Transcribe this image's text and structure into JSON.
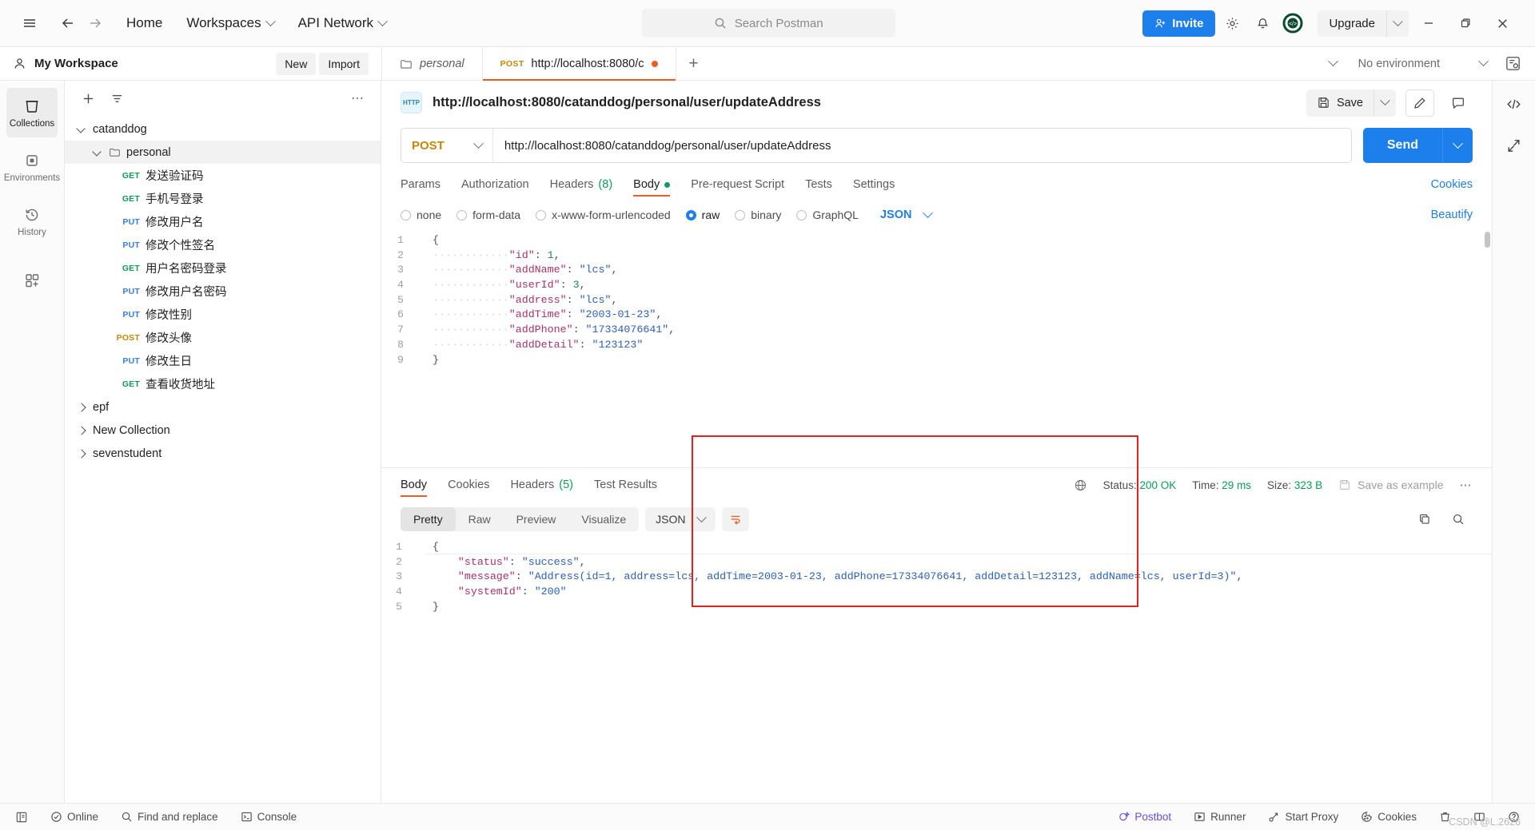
{
  "titlebar": {
    "menu_icon": "hamburger-icon",
    "back_icon": "back-arrow-icon",
    "forward_icon": "forward-arrow-icon",
    "home": "Home",
    "workspaces": "Workspaces",
    "api_network": "API Network",
    "search_placeholder": "Search Postman",
    "invite": "Invite",
    "settings_icon": "gear-icon",
    "notifications_icon": "bell-icon",
    "account_icon": "account-avatar-icon",
    "upgrade": "Upgrade",
    "minimize": "–",
    "maximize": "❐",
    "close": "✕"
  },
  "workspace": {
    "name": "My Workspace",
    "new": "New",
    "import": "Import"
  },
  "tabs": {
    "items": [
      {
        "label": "personal",
        "method": "",
        "active": false,
        "italic": true,
        "icon": "folder-icon"
      },
      {
        "label": "http://localhost:8080/c",
        "method": "POST",
        "active": true,
        "italic": false,
        "unsaved": true
      }
    ],
    "add": "+",
    "environment": "No environment"
  },
  "rail": {
    "items": [
      {
        "label": "Collections",
        "icon": "collections-icon",
        "active": true
      },
      {
        "label": "Environments",
        "icon": "environments-icon",
        "active": false
      },
      {
        "label": "History",
        "icon": "history-icon",
        "active": false
      },
      {
        "label": "",
        "icon": "add-apps-icon",
        "active": false
      }
    ]
  },
  "sidebar": {
    "add_icon": "plus-icon",
    "filter_icon": "filter-icon",
    "more_icon": "more-options-icon",
    "tree": [
      {
        "depth": 0,
        "type": "collection",
        "label": "catanddog",
        "expanded": true
      },
      {
        "depth": 1,
        "type": "folder",
        "label": "personal",
        "expanded": true,
        "selected": true
      },
      {
        "depth": 2,
        "type": "request",
        "method": "GET",
        "label": "发送验证码"
      },
      {
        "depth": 2,
        "type": "request",
        "method": "GET",
        "label": "手机号登录"
      },
      {
        "depth": 2,
        "type": "request",
        "method": "PUT",
        "label": "修改用户名"
      },
      {
        "depth": 2,
        "type": "request",
        "method": "PUT",
        "label": "修改个性签名"
      },
      {
        "depth": 2,
        "type": "request",
        "method": "GET",
        "label": "用户名密码登录"
      },
      {
        "depth": 2,
        "type": "request",
        "method": "PUT",
        "label": "修改用户名密码"
      },
      {
        "depth": 2,
        "type": "request",
        "method": "PUT",
        "label": "修改性别"
      },
      {
        "depth": 2,
        "type": "request",
        "method": "POST",
        "label": "修改头像"
      },
      {
        "depth": 2,
        "type": "request",
        "method": "PUT",
        "label": "修改生日"
      },
      {
        "depth": 2,
        "type": "request",
        "method": "GET",
        "label": "查看收货地址"
      },
      {
        "depth": 0,
        "type": "collection",
        "label": "epf",
        "expanded": false
      },
      {
        "depth": 0,
        "type": "collection",
        "label": "New Collection",
        "expanded": false
      },
      {
        "depth": 0,
        "type": "collection",
        "label": "sevenstudent",
        "expanded": false
      }
    ]
  },
  "request": {
    "protocol_badge": "HTTP",
    "title": "http://localhost:8080/catanddog/personal/user/updateAddress",
    "save": "Save",
    "edit_icon": "pencil-icon",
    "comment_icon": "comment-icon",
    "method": "POST",
    "url": "http://localhost:8080/catanddog/personal/user/updateAddress",
    "send": "Send",
    "tabs": [
      {
        "label": "Params",
        "active": false
      },
      {
        "label": "Authorization",
        "active": false
      },
      {
        "label": "Headers",
        "count": "(8)",
        "active": false
      },
      {
        "label": "Body",
        "dot": true,
        "active": true
      },
      {
        "label": "Pre-request Script",
        "active": false
      },
      {
        "label": "Tests",
        "active": false
      },
      {
        "label": "Settings",
        "active": false
      }
    ],
    "cookies": "Cookies",
    "body_types": [
      {
        "label": "none",
        "selected": false
      },
      {
        "label": "form-data",
        "selected": false
      },
      {
        "label": "x-www-form-urlencoded",
        "selected": false
      },
      {
        "label": "raw",
        "selected": true
      },
      {
        "label": "binary",
        "selected": false
      },
      {
        "label": "GraphQL",
        "selected": false
      }
    ],
    "format": "JSON",
    "beautify": "Beautify",
    "body_lines": [
      {
        "n": "1",
        "segs": [
          {
            "t": "{",
            "c": "p"
          }
        ]
      },
      {
        "n": "2",
        "segs": [
          {
            "t": "············",
            "c": "ind"
          },
          {
            "t": "\"id\"",
            "c": "k"
          },
          {
            "t": ": ",
            "c": "p"
          },
          {
            "t": "1",
            "c": "n"
          },
          {
            "t": ",",
            "c": "p"
          }
        ]
      },
      {
        "n": "3",
        "segs": [
          {
            "t": "············",
            "c": "ind"
          },
          {
            "t": "\"addName\"",
            "c": "k"
          },
          {
            "t": ": ",
            "c": "p"
          },
          {
            "t": "\"lcs\"",
            "c": "s"
          },
          {
            "t": ",",
            "c": "p"
          }
        ]
      },
      {
        "n": "4",
        "segs": [
          {
            "t": "············",
            "c": "ind"
          },
          {
            "t": "\"userId\"",
            "c": "k"
          },
          {
            "t": ": ",
            "c": "p"
          },
          {
            "t": "3",
            "c": "n"
          },
          {
            "t": ",",
            "c": "p"
          }
        ]
      },
      {
        "n": "5",
        "segs": [
          {
            "t": "············",
            "c": "ind"
          },
          {
            "t": "\"address\"",
            "c": "k"
          },
          {
            "t": ": ",
            "c": "p"
          },
          {
            "t": "\"lcs\"",
            "c": "s"
          },
          {
            "t": ",",
            "c": "p"
          }
        ]
      },
      {
        "n": "6",
        "segs": [
          {
            "t": "············",
            "c": "ind"
          },
          {
            "t": "\"addTime\"",
            "c": "k"
          },
          {
            "t": ": ",
            "c": "p"
          },
          {
            "t": "\"2003-01-23\"",
            "c": "s"
          },
          {
            "t": ",",
            "c": "p"
          }
        ]
      },
      {
        "n": "7",
        "segs": [
          {
            "t": "············",
            "c": "ind"
          },
          {
            "t": "\"addPhone\"",
            "c": "k"
          },
          {
            "t": ": ",
            "c": "p"
          },
          {
            "t": "\"17334076641\"",
            "c": "s"
          },
          {
            "t": ",",
            "c": "p"
          }
        ]
      },
      {
        "n": "8",
        "segs": [
          {
            "t": "············",
            "c": "ind"
          },
          {
            "t": "\"addDetail\"",
            "c": "k"
          },
          {
            "t": ": ",
            "c": "p"
          },
          {
            "t": "\"123123\"",
            "c": "s"
          }
        ]
      },
      {
        "n": "9",
        "segs": [
          {
            "t": "}",
            "c": "p"
          }
        ]
      }
    ]
  },
  "response": {
    "tabs": [
      {
        "label": "Body",
        "active": true
      },
      {
        "label": "Cookies",
        "active": false
      },
      {
        "label": "Headers",
        "count": "(5)",
        "active": false
      },
      {
        "label": "Test Results",
        "active": false
      }
    ],
    "globe_icon": "globe-icon",
    "status_label": "Status:",
    "status_value": "200 OK",
    "time_label": "Time:",
    "time_value": "29 ms",
    "size_label": "Size:",
    "size_value": "323 B",
    "save_example": "Save as example",
    "save_icon": "floppy-icon",
    "more_icon": "more-options-icon",
    "view_modes": [
      {
        "label": "Pretty",
        "active": true
      },
      {
        "label": "Raw",
        "active": false
      },
      {
        "label": "Preview",
        "active": false
      },
      {
        "label": "Visualize",
        "active": false
      }
    ],
    "format": "JSON",
    "wrap_icon": "word-wrap-icon",
    "copy_icon": "copy-icon",
    "search_icon": "search-icon",
    "body_lines": [
      {
        "n": "1",
        "segs": [
          {
            "t": "{",
            "c": "p"
          }
        ]
      },
      {
        "n": "2",
        "segs": [
          {
            "t": "    ",
            "c": "p"
          },
          {
            "t": "\"status\"",
            "c": "k"
          },
          {
            "t": ": ",
            "c": "p"
          },
          {
            "t": "\"success\"",
            "c": "s"
          },
          {
            "t": ",",
            "c": "p"
          }
        ]
      },
      {
        "n": "3",
        "segs": [
          {
            "t": "    ",
            "c": "p"
          },
          {
            "t": "\"message\"",
            "c": "k"
          },
          {
            "t": ": ",
            "c": "p"
          },
          {
            "t": "\"Address(id=1, address=lcs, addTime=2003-01-23, addPhone=17334076641, addDetail=123123, addName=lcs, userId=3)\"",
            "c": "s"
          },
          {
            "t": ",",
            "c": "p"
          }
        ]
      },
      {
        "n": "4",
        "segs": [
          {
            "t": "    ",
            "c": "p"
          },
          {
            "t": "\"systemId\"",
            "c": "k"
          },
          {
            "t": ": ",
            "c": "p"
          },
          {
            "t": "\"200\"",
            "c": "s"
          }
        ]
      },
      {
        "n": "5",
        "segs": [
          {
            "t": "}",
            "c": "p"
          }
        ]
      }
    ]
  },
  "right_rail": {
    "items": [
      {
        "icon": "code-snippet-icon"
      },
      {
        "icon": "expand-collapse-icon"
      }
    ]
  },
  "statusbar": {
    "layout_icon": "sidebar-toggle-icon",
    "online": "Online",
    "find_replace": "Find and replace",
    "console": "Console",
    "postbot": "Postbot",
    "runner": "Runner",
    "start_proxy": "Start Proxy",
    "cookies": "Cookies",
    "trash_icon": "trash-icon",
    "two_pane_icon": "two-pane-icon",
    "help_icon": "help-icon",
    "watermark": "CSDN @L.2626"
  },
  "colors": {
    "accent_blue": "#1d7fec",
    "accent_orange": "#ef5b25",
    "green": "#0f9b57",
    "annotation_red": "#e8201b",
    "method_post": "#c8860a",
    "method_get": "#0f9b57",
    "method_put": "#3a7de0"
  }
}
